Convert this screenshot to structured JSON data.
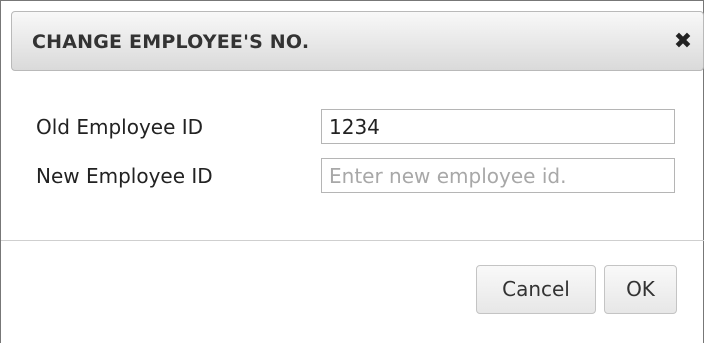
{
  "dialog": {
    "title": "CHANGE EMPLOYEE'S NO.",
    "close_icon": "close-icon"
  },
  "form": {
    "old_label": "Old Employee ID",
    "old_value": "1234",
    "new_label": "New Employee ID",
    "new_placeholder": "Enter new employee id.",
    "new_value": ""
  },
  "buttons": {
    "cancel_label": "Cancel",
    "ok_label": "OK"
  }
}
